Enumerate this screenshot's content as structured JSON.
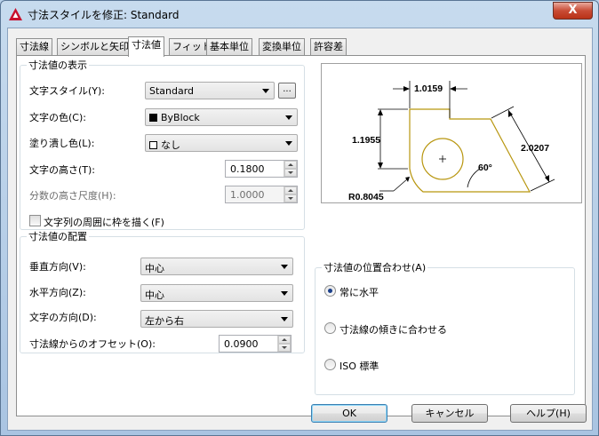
{
  "window": {
    "title": "寸法スタイルを修正: Standard",
    "close_label": "X"
  },
  "tabs": [
    "寸法線",
    "シンボルと矢印",
    "寸法値",
    "フィット",
    "基本単位",
    "変換単位",
    "許容差"
  ],
  "text_appearance": {
    "legend": "寸法値の表示",
    "style_label": "文字スタイル(Y):",
    "style_value": "Standard",
    "browse_label": "...",
    "color_label": "文字の色(C):",
    "color_value": "ByBlock",
    "fill_label": "塗り潰し色(L):",
    "fill_value": "なし",
    "height_label": "文字の高さ(T):",
    "height_value": "0.1800",
    "fraction_label": "分数の高さ尺度(H):",
    "fraction_value": "1.0000",
    "frame_label": "文字列の周囲に枠を描く(F)"
  },
  "text_placement": {
    "legend": "寸法値の配置",
    "vertical_label": "垂直方向(V):",
    "vertical_value": "中心",
    "horizontal_label": "水平方向(Z):",
    "horizontal_value": "中心",
    "direction_label": "文字の方向(D):",
    "direction_value": "左から右",
    "offset_label": "寸法線からのオフセット(O):",
    "offset_value": "0.0900"
  },
  "text_alignment": {
    "legend": "寸法値の位置合わせ(A)",
    "options": [
      "常に水平",
      "寸法線の傾きに合わせる",
      "ISO 標準"
    ],
    "selected": 0
  },
  "preview": {
    "dim_top": "1.0159",
    "dim_left": "1.1955",
    "dim_right": "2.0207",
    "angle": "60°",
    "radius": "R0.8045"
  },
  "buttons": {
    "ok": "OK",
    "cancel": "キャンセル",
    "help": "ヘルプ(H)"
  },
  "colors": {
    "accent": "#1a3f8a",
    "preview_geometry": "#b8960f"
  }
}
